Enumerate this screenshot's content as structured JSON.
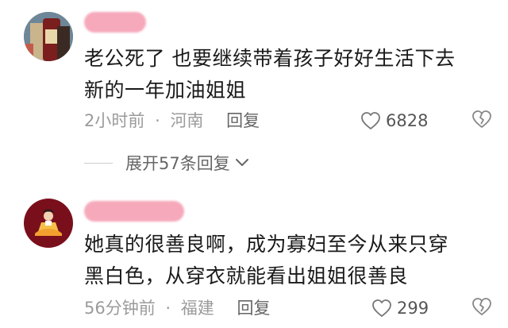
{
  "comments": [
    {
      "text_line1": "老公死了 也要继续带着孩子好好生活下去",
      "text_line2": "新的一年加油姐姐",
      "time": "2小时前",
      "separator": "·",
      "location": "河南",
      "reply_label": "回复",
      "likes": "6828",
      "expand_label": "展开57条回复"
    },
    {
      "text_line1": "她真的很善良啊，成为寡妇至今从来只穿",
      "text_line2": "黑白色，从穿衣就能看出姐姐很善良",
      "time": "56分钟前",
      "separator": "·",
      "location": "福建",
      "reply_label": "回复",
      "likes": "299"
    }
  ],
  "colors": {
    "name_blur": "#f6a9bb",
    "text": "#1a1a1a",
    "meta": "#9b9b9b"
  },
  "icons": [
    "heart-outline-icon",
    "broken-heart-icon",
    "chevron-down-icon"
  ]
}
